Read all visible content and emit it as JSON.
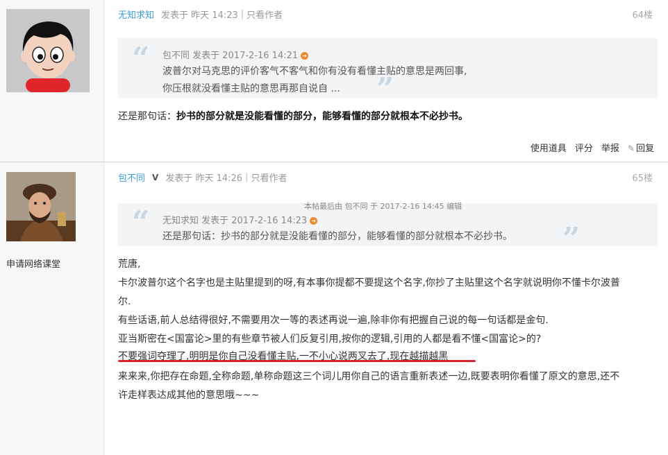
{
  "colors": {
    "author_link": "#3a9ddb",
    "quote_bg": "#f3f4f6",
    "underline": "#d8232a",
    "sidebar_bg": "#f6f7f9"
  },
  "posts": [
    {
      "author": "无知求知",
      "posted_at": "发表于 昨天 14:23",
      "only_author": "只看作者",
      "floor": "64楼",
      "avatar_icon": "cartoon-avatar-icon",
      "quote": {
        "meta": "包不同 发表于 2017-2-16 14:21",
        "lines": [
          "波普尔对马克思的评价客气不客气和你有没有看懂主贴的意思是两回事,",
          "你压根就没看懂主贴的意思再那自说自 ..."
        ]
      },
      "body_prefix": "还是那句话：",
      "body_bold": "抄书的部分就是没能看懂的部分，能够看懂的部分就根本不必抄书。",
      "actions": {
        "tools": "使用道具",
        "rate": "评分",
        "report": "举报",
        "reply": "回复"
      }
    },
    {
      "author": "包不同",
      "vip": "V",
      "posted_at": "发表于 昨天 14:26",
      "only_author": "只看作者",
      "floor": "65楼",
      "avatar_icon": "portrait-avatar-icon",
      "side_label": "申请网络课堂",
      "edit_note": "本帖最后由 包不同 于 2017-2-16 14:45 编辑",
      "quote": {
        "meta": "无知求知 发表于 2017-2-16 14:23",
        "lines": [
          "还是那句话：抄书的部分就是没能看懂的部分，能够看懂的部分就根本不必抄书。"
        ]
      },
      "body_lines": [
        "荒唐,",
        "卡尔波普尔这个名字也是主贴里提到的呀,有本事你提都不要提这个名字,你抄了主贴里这个名字就说明你不懂卡尔波普",
        "尔.",
        "有些话语,前人总结得很好,不需要用次一等的表述再说一遍,除非你有把握自己说的每一句话都是金句.",
        "亚当斯密在<国富论>里的有些章节被人们反复引用,按你的逻辑,引用的人都是看不懂<国富论>的?",
        "不要强词夺理了,明明是你自己没看懂主贴,一不小心说两叉去了,现在越描越黑",
        "来来来,你把存在命题,全称命题,单称命题这三个词儿用你自己的语言重新表述一边,既要表明你看懂了原文的意思,还不",
        "许走样表达成其他的意思哦~~~"
      ]
    }
  ]
}
